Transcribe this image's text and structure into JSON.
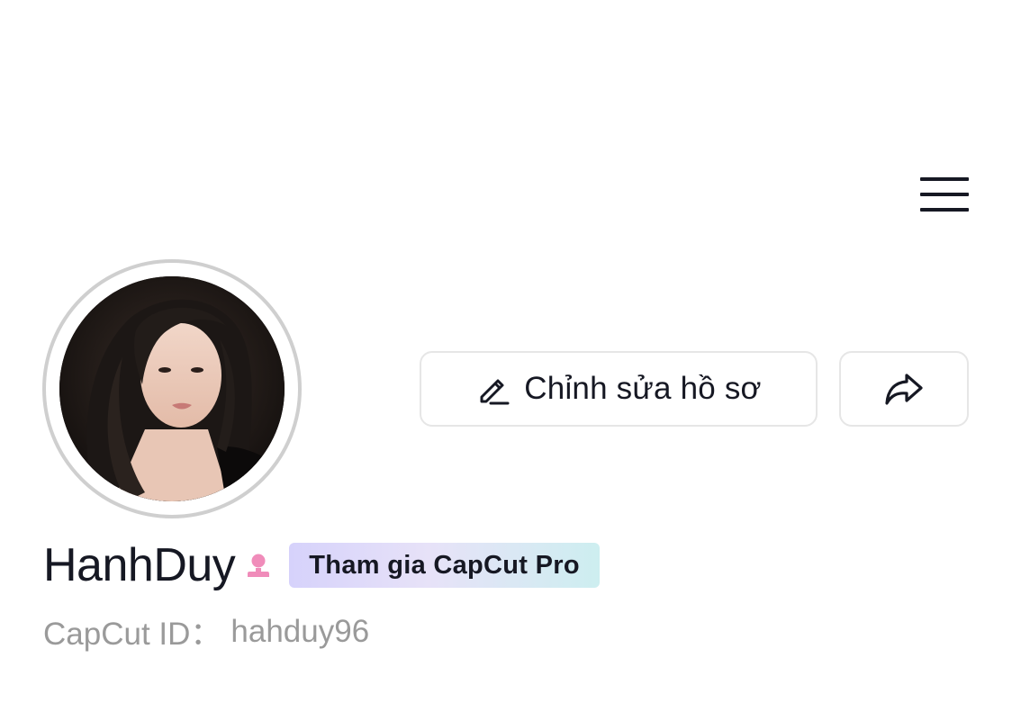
{
  "header": {
    "menu_icon": "hamburger-menu-icon"
  },
  "profile": {
    "username": "HanhDuy",
    "gender_icon": "female-user-icon",
    "pro_badge_label": "Tham gia CapCut Pro",
    "capcut_id_label": "CapCut ID：",
    "capcut_id_value": "hahduy96"
  },
  "actions": {
    "edit_profile_label": "Chỉnh sửa hồ sơ",
    "edit_icon": "pencil-icon",
    "share_icon": "share-arrow-icon"
  },
  "colors": {
    "text_primary": "#161823",
    "text_secondary": "#9a9a9a",
    "button_border": "#e6e6e6",
    "gender_icon": "#f08cba",
    "badge_gradient_start": "#d6d2fb",
    "badge_gradient_end": "#cdeef0"
  }
}
